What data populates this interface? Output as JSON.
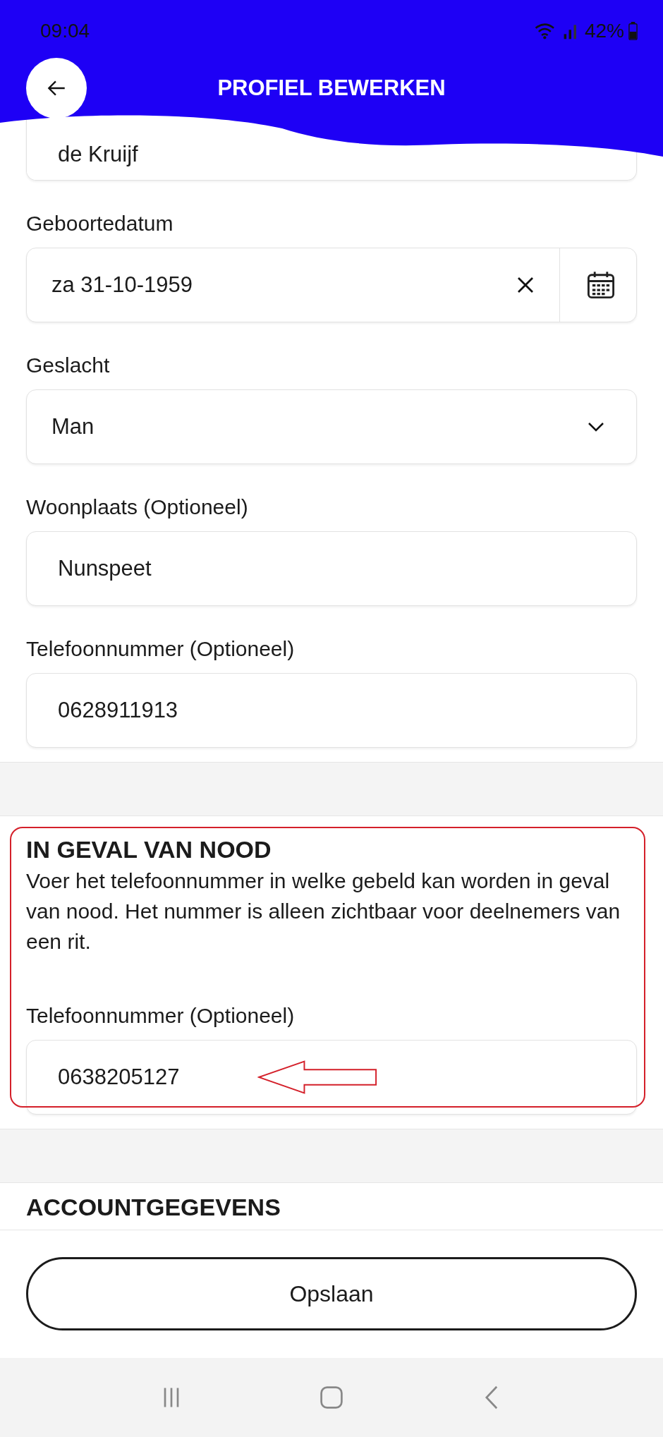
{
  "status_bar": {
    "time": "09:04",
    "battery": "42%"
  },
  "header": {
    "title": "PROFIEL BEWERKEN"
  },
  "profile_fields": [
    {
      "kind": "text",
      "value": "de Kruijf"
    },
    {
      "kind": "date",
      "label": "Geboortedatum",
      "value": "za 31-10-1959"
    },
    {
      "kind": "select",
      "label": "Geslacht",
      "value": "Man"
    },
    {
      "kind": "text",
      "label": "Woonplaats (Optioneel)",
      "value": "Nunspeet"
    },
    {
      "kind": "text",
      "label": "Telefoonnummer (Optioneel)",
      "value": "0628911913"
    }
  ],
  "emergency": {
    "title": "IN GEVAL VAN NOOD",
    "description": "Voer het telefoonnummer in welke gebeld kan worden in geval van nood. Het nummer is alleen zichtbaar voor deelnemers van een rit.",
    "field": {
      "label": "Telefoonnummer (Optioneel)",
      "value": "0638205127"
    }
  },
  "account": {
    "title": "ACCOUNTGEGEVENS"
  },
  "save_button": "Opslaan"
}
